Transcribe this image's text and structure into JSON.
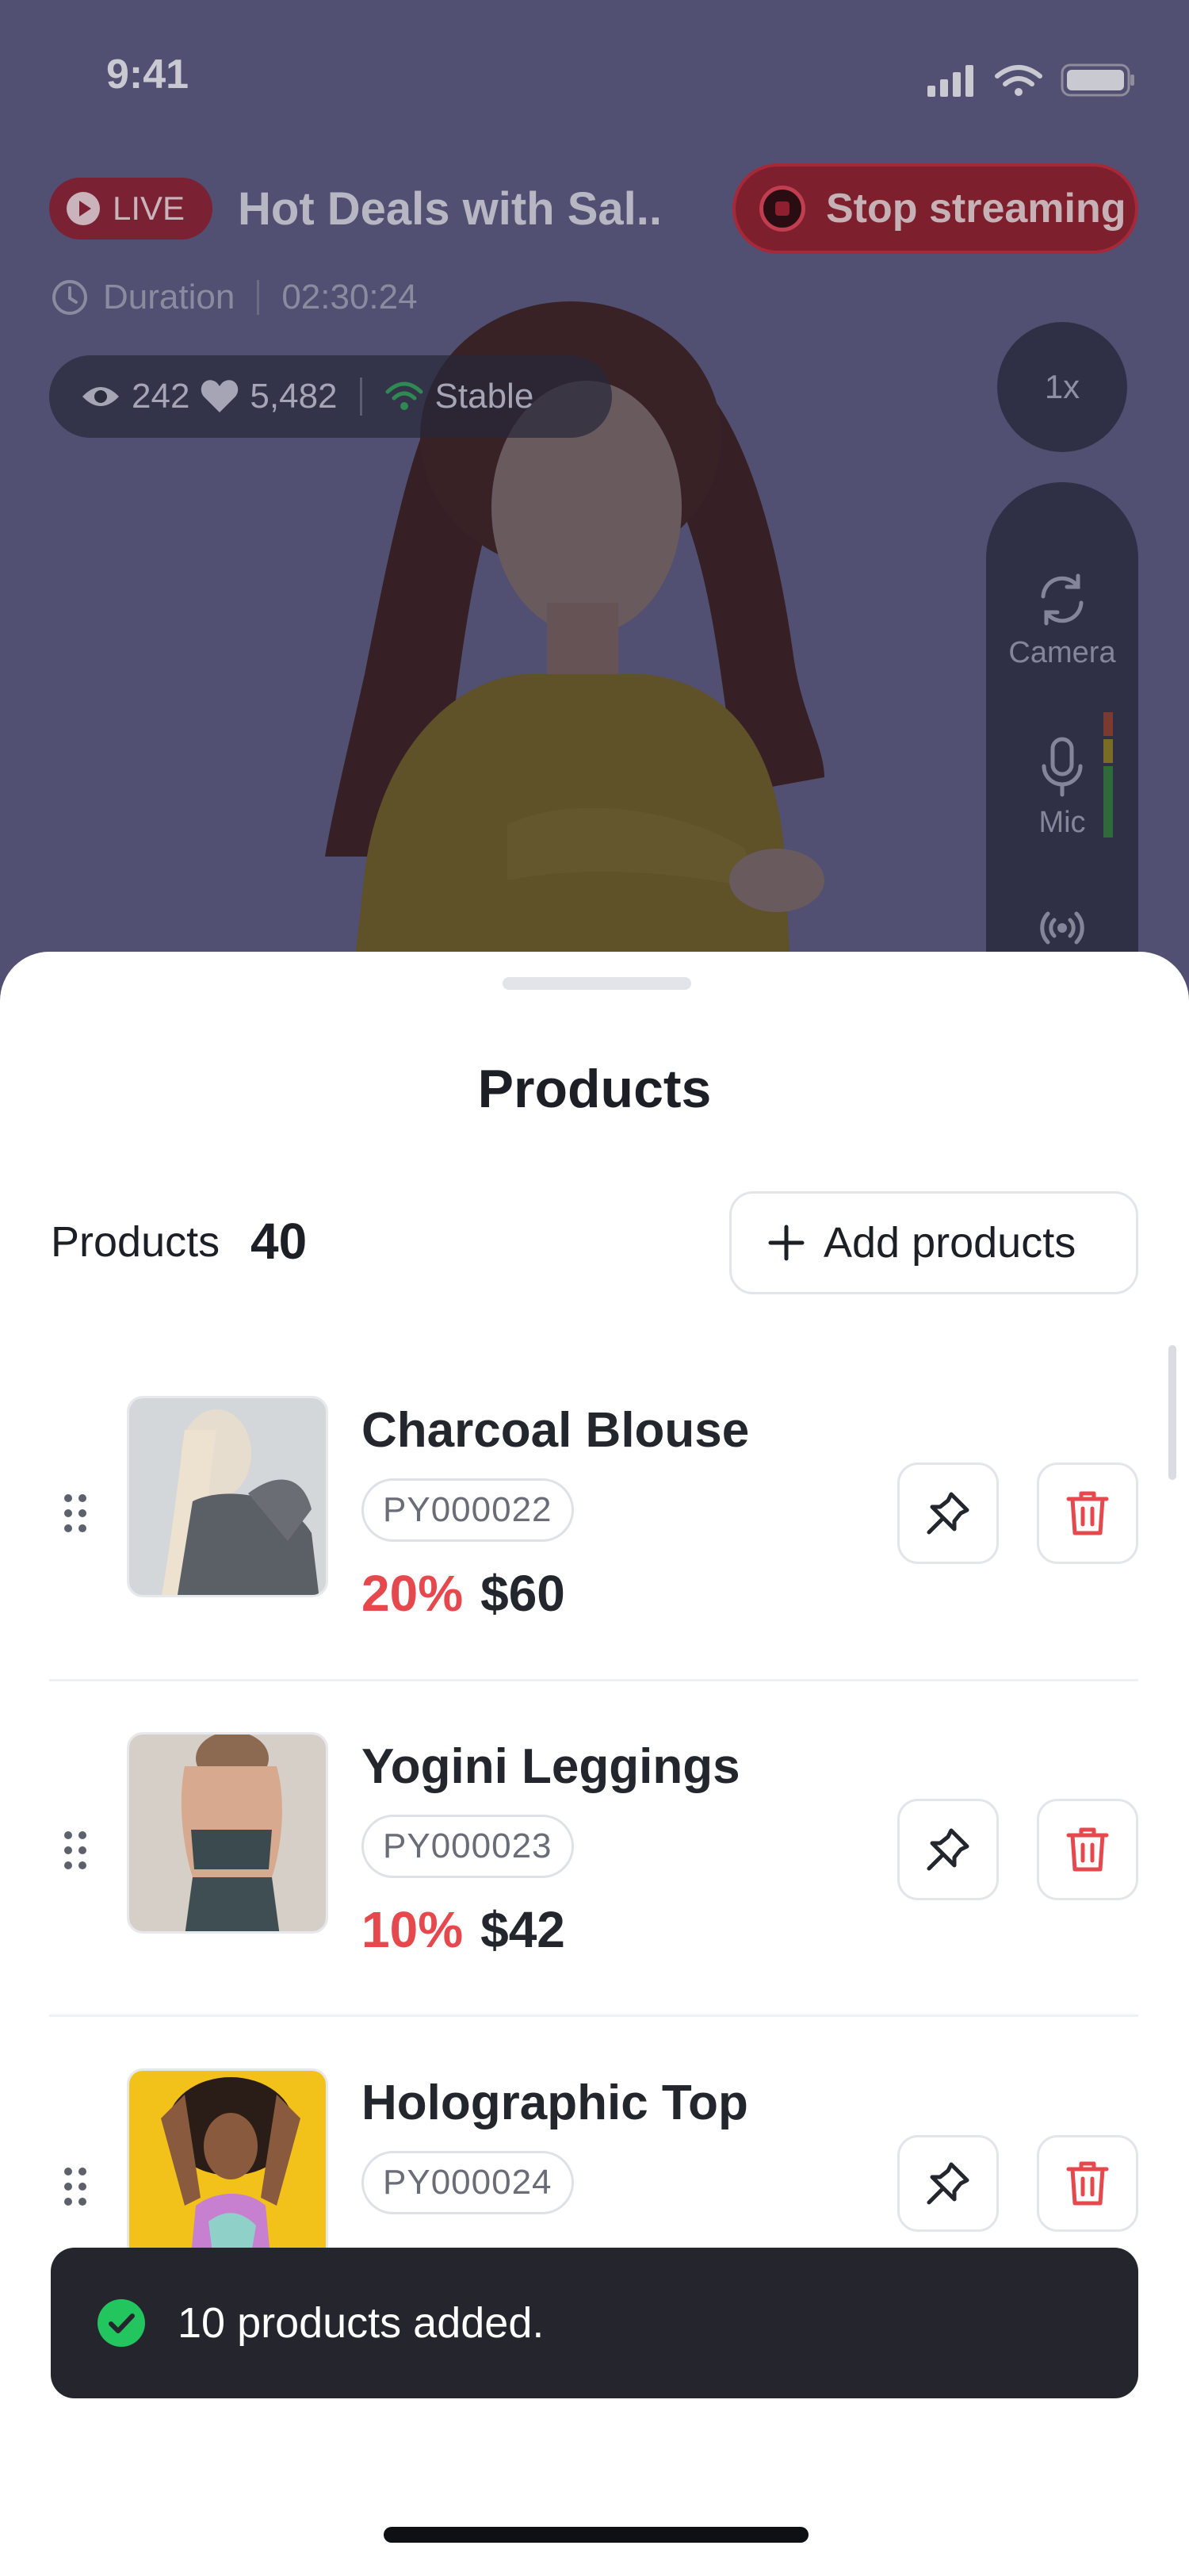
{
  "status_bar": {
    "time": "9:41"
  },
  "live": {
    "badge": "LIVE",
    "title": "Hot Deals with Sal..",
    "stop_label": "Stop streaming",
    "duration_label": "Duration",
    "duration_value": "02:30:24",
    "viewers": "242",
    "likes": "5,482",
    "connection": "Stable",
    "speed": "1x",
    "controls": {
      "camera": "Camera",
      "mic": "Mic"
    }
  },
  "sheet": {
    "title": "Products",
    "count_label": "Products",
    "count": "40",
    "add_label": "Add products"
  },
  "products": [
    {
      "name": "Charcoal Blouse",
      "sku": "PY000022",
      "discount": "20%",
      "price": "$60"
    },
    {
      "name": "Yogini Leggings",
      "sku": "PY000023",
      "discount": "10%",
      "price": "$42"
    },
    {
      "name": "Holographic Top",
      "sku": "PY000024"
    }
  ],
  "toast": {
    "message": "10 products added."
  },
  "colors": {
    "accent_red": "#e5484d",
    "success_green": "#22c55e",
    "toast_bg": "#25262d"
  }
}
